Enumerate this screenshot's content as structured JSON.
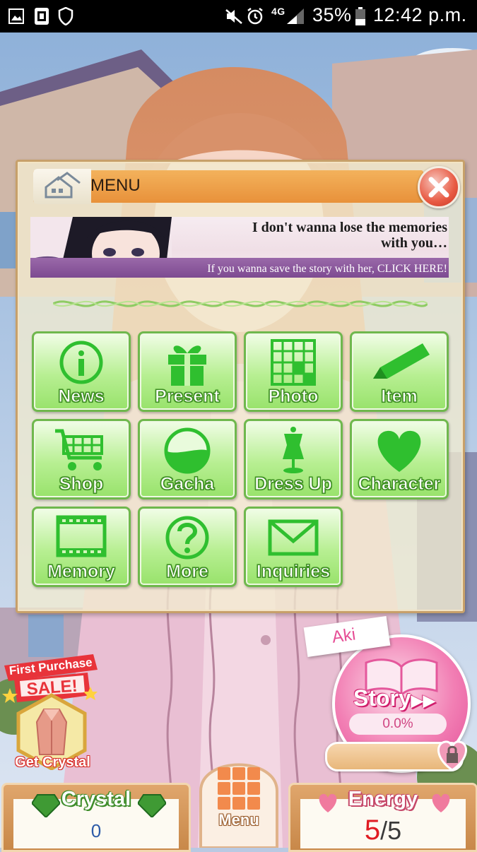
{
  "status_bar": {
    "battery": "35%",
    "time": "12:42 p.m.",
    "network": "4G",
    "icons": [
      "gallery-icon",
      "sim-icon",
      "shield-icon",
      "mute-icon",
      "alarm-icon",
      "signal-icon",
      "battery-icon"
    ]
  },
  "menu": {
    "title": "MENU",
    "banner": {
      "headline_1": "I don't wanna lose the memories",
      "headline_2": "with you…",
      "subtext": "If you wanna save the story with her, CLICK HERE!"
    },
    "buttons": [
      {
        "label": "News",
        "icon": "info-icon"
      },
      {
        "label": "Present",
        "icon": "gift-icon"
      },
      {
        "label": "Photo",
        "icon": "photo-grid-icon"
      },
      {
        "label": "Item",
        "icon": "pen-icon"
      },
      {
        "label": "Shop",
        "icon": "cart-icon"
      },
      {
        "label": "Gacha",
        "icon": "gacha-ball-icon"
      },
      {
        "label": "Dress Up",
        "icon": "mannequin-icon"
      },
      {
        "label": "Character",
        "icon": "heart-icon"
      },
      {
        "label": "Memory",
        "icon": "film-icon"
      },
      {
        "label": "More",
        "icon": "question-icon"
      },
      {
        "label": "Inquiries",
        "icon": "mail-icon"
      }
    ]
  },
  "promo": {
    "sale_line_1": "First Purchase",
    "sale_line_2": "SALE!",
    "get_crystal": "Get Crystal"
  },
  "story": {
    "character": "Aki",
    "label": "Story",
    "progress": "0.0%"
  },
  "footer": {
    "crystal_label": "Crystal",
    "crystal_value": "0",
    "menu_label": "Menu",
    "energy_label": "Energy",
    "energy_current": "5",
    "energy_max": "/5"
  },
  "colors": {
    "menu_green": "#98e26b",
    "title_orange": "#e8913a",
    "story_pink": "#f27fb4"
  }
}
